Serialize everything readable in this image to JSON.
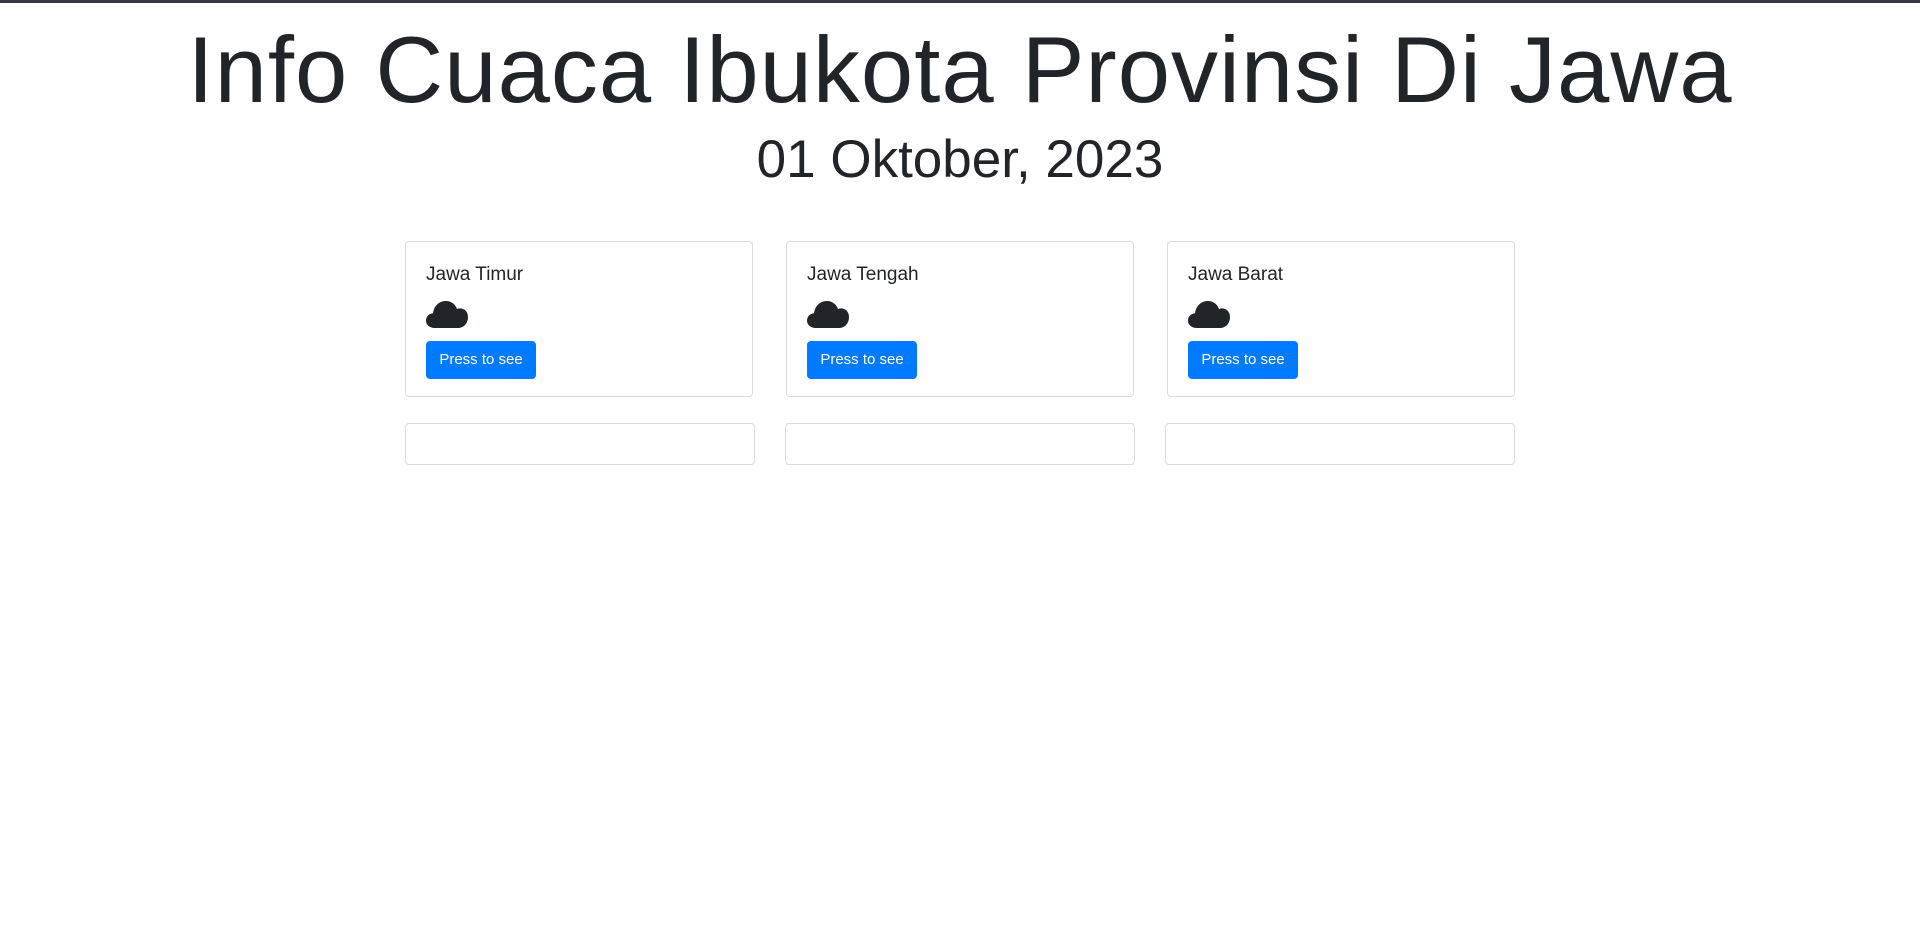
{
  "header": {
    "title": "Info Cuaca Ibukota Provinsi Di Jawa",
    "date": "01 Oktober, 2023"
  },
  "colors": {
    "primary": "#007bff",
    "text": "#212529",
    "topbar": "#343a40",
    "border": "#dcdcdc"
  },
  "cards": [
    {
      "title": "Jawa Timur",
      "icon": "cloud-icon",
      "button_label": "Press to see"
    },
    {
      "title": "Jawa Tengah",
      "icon": "cloud-icon",
      "button_label": "Press to see"
    },
    {
      "title": "Jawa Barat",
      "icon": "cloud-icon",
      "button_label": "Press to see"
    }
  ]
}
